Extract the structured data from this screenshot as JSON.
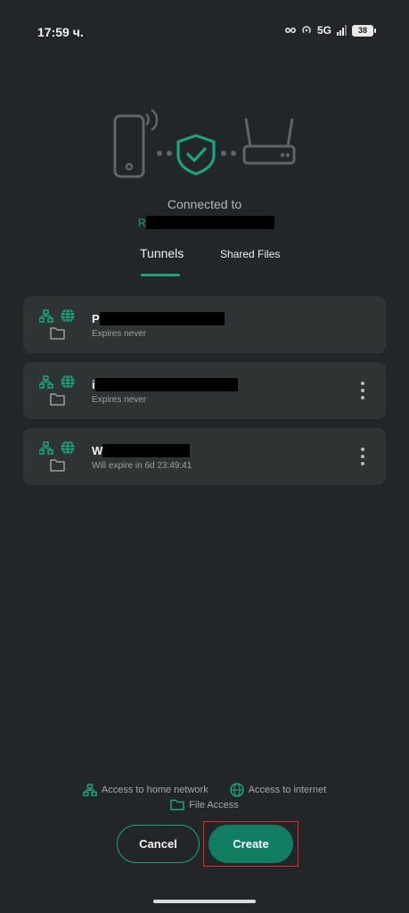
{
  "status_bar": {
    "time": "17:59 ч.",
    "network": "5G",
    "battery": "38"
  },
  "header": {
    "connected_label": "Connected to",
    "network_name_visible": "R"
  },
  "tabs": [
    {
      "label": "Tunnels",
      "active": true
    },
    {
      "label": "Shared Files",
      "active": false
    }
  ],
  "tunnels": [
    {
      "name_visible": "P",
      "subtitle": "Expires never",
      "has_menu": false
    },
    {
      "name_visible": "i",
      "subtitle": "Expires never",
      "has_menu": true
    },
    {
      "name_visible": "W",
      "subtitle": "Will expire in 6d 23:49:41",
      "has_menu": true
    }
  ],
  "legend": {
    "home_network": "Access to home network",
    "internet": "Access to internet",
    "file_access": "File Access"
  },
  "actions": {
    "cancel": "Cancel",
    "create": "Create"
  },
  "colors": {
    "accent": "#1aa37f",
    "background": "#222628",
    "card": "#2e3334",
    "create_button": "#117d62",
    "highlight": "#e5262a"
  }
}
